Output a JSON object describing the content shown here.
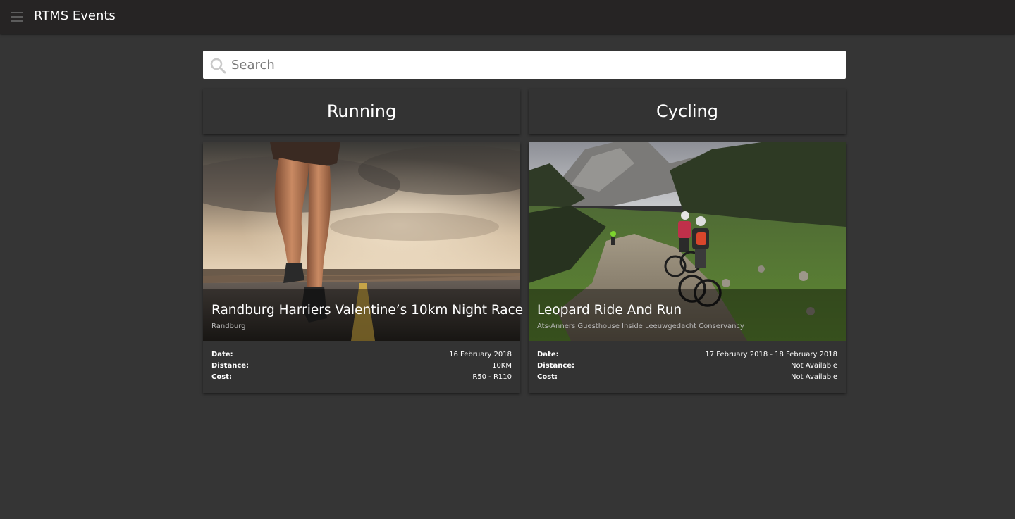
{
  "app": {
    "title": "RTMS Events"
  },
  "search": {
    "placeholder": "Search"
  },
  "categories": [
    {
      "label": "Running"
    },
    {
      "label": "Cycling"
    }
  ],
  "events": [
    {
      "title": "Randburg Harriers Valentine’s 10km Night Race",
      "location": "Randburg",
      "image": "runner-on-road",
      "details": [
        {
          "label": "Date:",
          "value": "16 February 2018"
        },
        {
          "label": "Distance:",
          "value": "10KM"
        },
        {
          "label": "Cost:",
          "value": "R50 - R110"
        }
      ]
    },
    {
      "title": "Leopard Ride And Run",
      "location": "Ats-Anners Guesthouse Inside Leeuwgedacht Conservancy",
      "image": "mountain-bikers-on-trail",
      "details": [
        {
          "label": "Date:",
          "value": "17 February 2018 - 18 February 2018"
        },
        {
          "label": "Distance:",
          "value": "Not Available"
        },
        {
          "label": "Cost:",
          "value": "Not Available"
        }
      ]
    }
  ],
  "colors": {
    "background": "#353535",
    "appbar": "#262424",
    "card": "#333333"
  }
}
